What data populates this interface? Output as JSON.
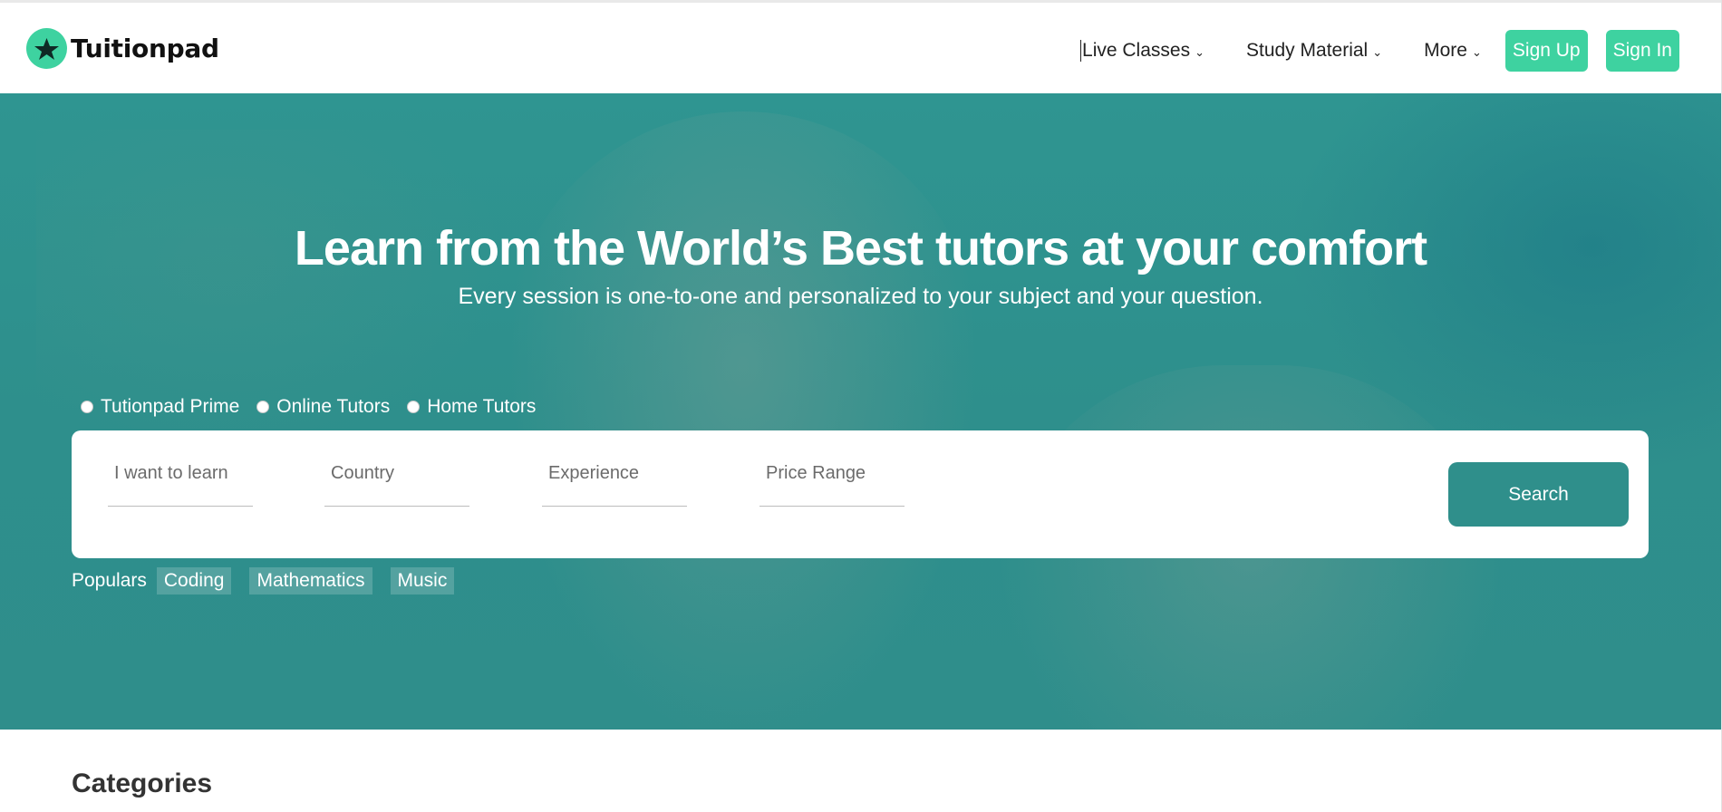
{
  "brand": {
    "name": "Tuitionpad",
    "accent": "#3ed2a0",
    "hero_teal": "#2f8f8b"
  },
  "nav": {
    "items": [
      {
        "label": "Live Classes",
        "icon": "chevron-down-icon"
      },
      {
        "label": "Study Material",
        "icon": "chevron-down-icon"
      },
      {
        "label": "More",
        "icon": "chevron-down-icon"
      }
    ],
    "chevron": "⌄",
    "signup_label": "Sign Up",
    "signin_label": "Sign In"
  },
  "hero": {
    "title": "Learn from the World’s Best tutors at your comfort",
    "subtitle": "Every session is one-to-one and personalized to your subject and your question.",
    "tutor_types": [
      "Tutionpad Prime",
      "Online Tutors",
      "Home Tutors"
    ],
    "search": {
      "learn_placeholder": "I want to learn",
      "country_placeholder": "Country",
      "experience_placeholder": "Experience",
      "price_placeholder": "Price Range",
      "button_label": "Search"
    },
    "populars_label": "Populars",
    "popular_chips": [
      "Coding",
      "Mathematics",
      "Music"
    ]
  },
  "sections": {
    "categories_title": "Categories"
  }
}
